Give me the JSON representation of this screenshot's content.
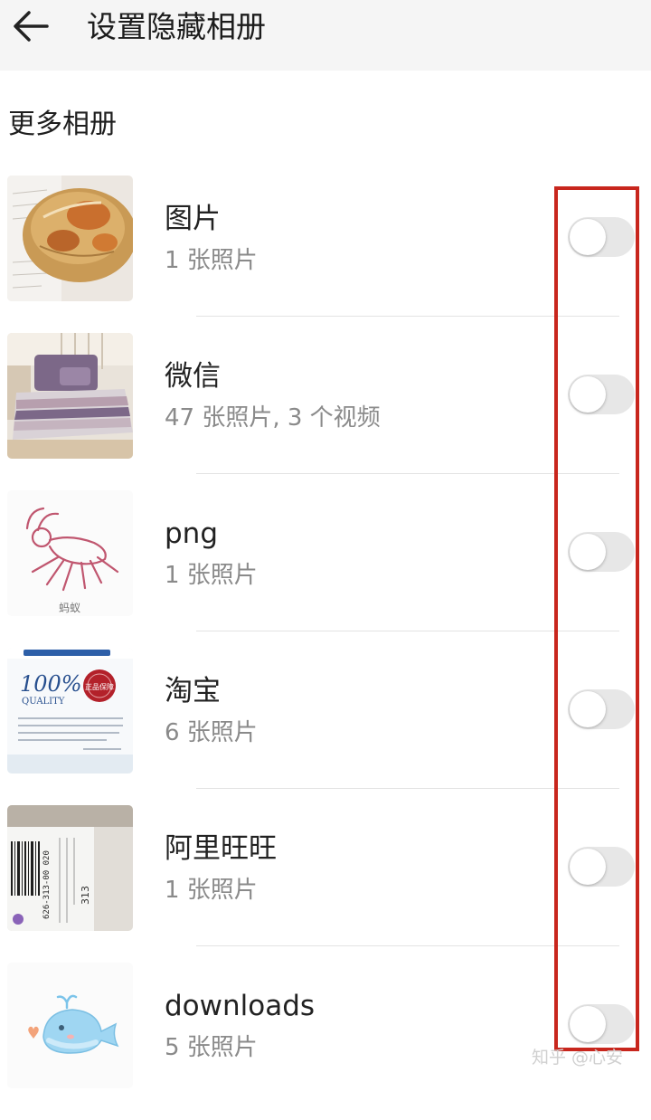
{
  "header": {
    "title": "设置隐藏相册",
    "back_icon": "arrow-left-icon"
  },
  "section": {
    "title": "更多相册"
  },
  "albums": [
    {
      "name": "图片",
      "count": "1 张照片",
      "thumbnail": "bread-photo",
      "hidden": false
    },
    {
      "name": "微信",
      "count": "47 张照片, 3 个视频",
      "thumbnail": "bedding-photo",
      "hidden": false
    },
    {
      "name": "png",
      "count": "1 张照片",
      "thumbnail": "ant-drawing",
      "thumbnail_caption": "蚂蚁",
      "hidden": false
    },
    {
      "name": "淘宝",
      "count": "6 张照片",
      "thumbnail": "quality-certificate",
      "thumbnail_text": {
        "percent": "100%",
        "quality": "QUALITY",
        "seal": "正品保障"
      },
      "hidden": false
    },
    {
      "name": "阿里旺旺",
      "count": "1 张照片",
      "thumbnail": "barcode-label",
      "thumbnail_text": {
        "barcode_number": "626-313-00 020",
        "code": "313"
      },
      "hidden": false
    },
    {
      "name": "downloads",
      "count": "5 张照片",
      "thumbnail": "whale-drawing",
      "hidden": false
    }
  ],
  "watermark": "知乎 @心安",
  "colors": {
    "highlight": "#c8261d",
    "toggle_off": "#e7e7e7",
    "header_bg": "#f5f5f5"
  }
}
